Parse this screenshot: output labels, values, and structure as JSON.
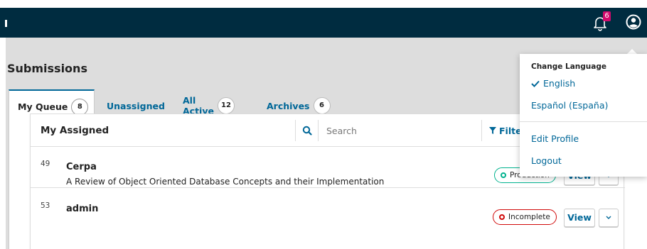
{
  "header": {
    "notification_count": "6",
    "colors": {
      "bar": "#002c40",
      "badge": "#d00a6c",
      "accent": "#006798"
    }
  },
  "page": {
    "title": "Submissions"
  },
  "tabs": [
    {
      "label": "My Queue",
      "count": "8",
      "active": true
    },
    {
      "label": "Unassigned",
      "count": ""
    },
    {
      "label": "All Active",
      "count": "12"
    },
    {
      "label": "Archives",
      "count": "6"
    }
  ],
  "list": {
    "title": "My Assigned",
    "search_placeholder": "Search",
    "filter_label": "Filte",
    "rows": [
      {
        "id": "49",
        "author": "Cerpa",
        "title": "A Review of Object Oriented Database Concepts and their Implementation",
        "status": "Production",
        "status_color": "#00b28e",
        "view_label": "View"
      },
      {
        "id": "53",
        "author": "admin",
        "title": "",
        "status": "Incomplete",
        "status_color": "#d00a0a",
        "view_label": "View"
      }
    ]
  },
  "user_menu": {
    "heading": "Change Language",
    "languages": [
      {
        "label": "English",
        "selected": true
      },
      {
        "label": "Español (España)",
        "selected": false
      }
    ],
    "edit_profile": "Edit Profile",
    "logout": "Logout"
  }
}
